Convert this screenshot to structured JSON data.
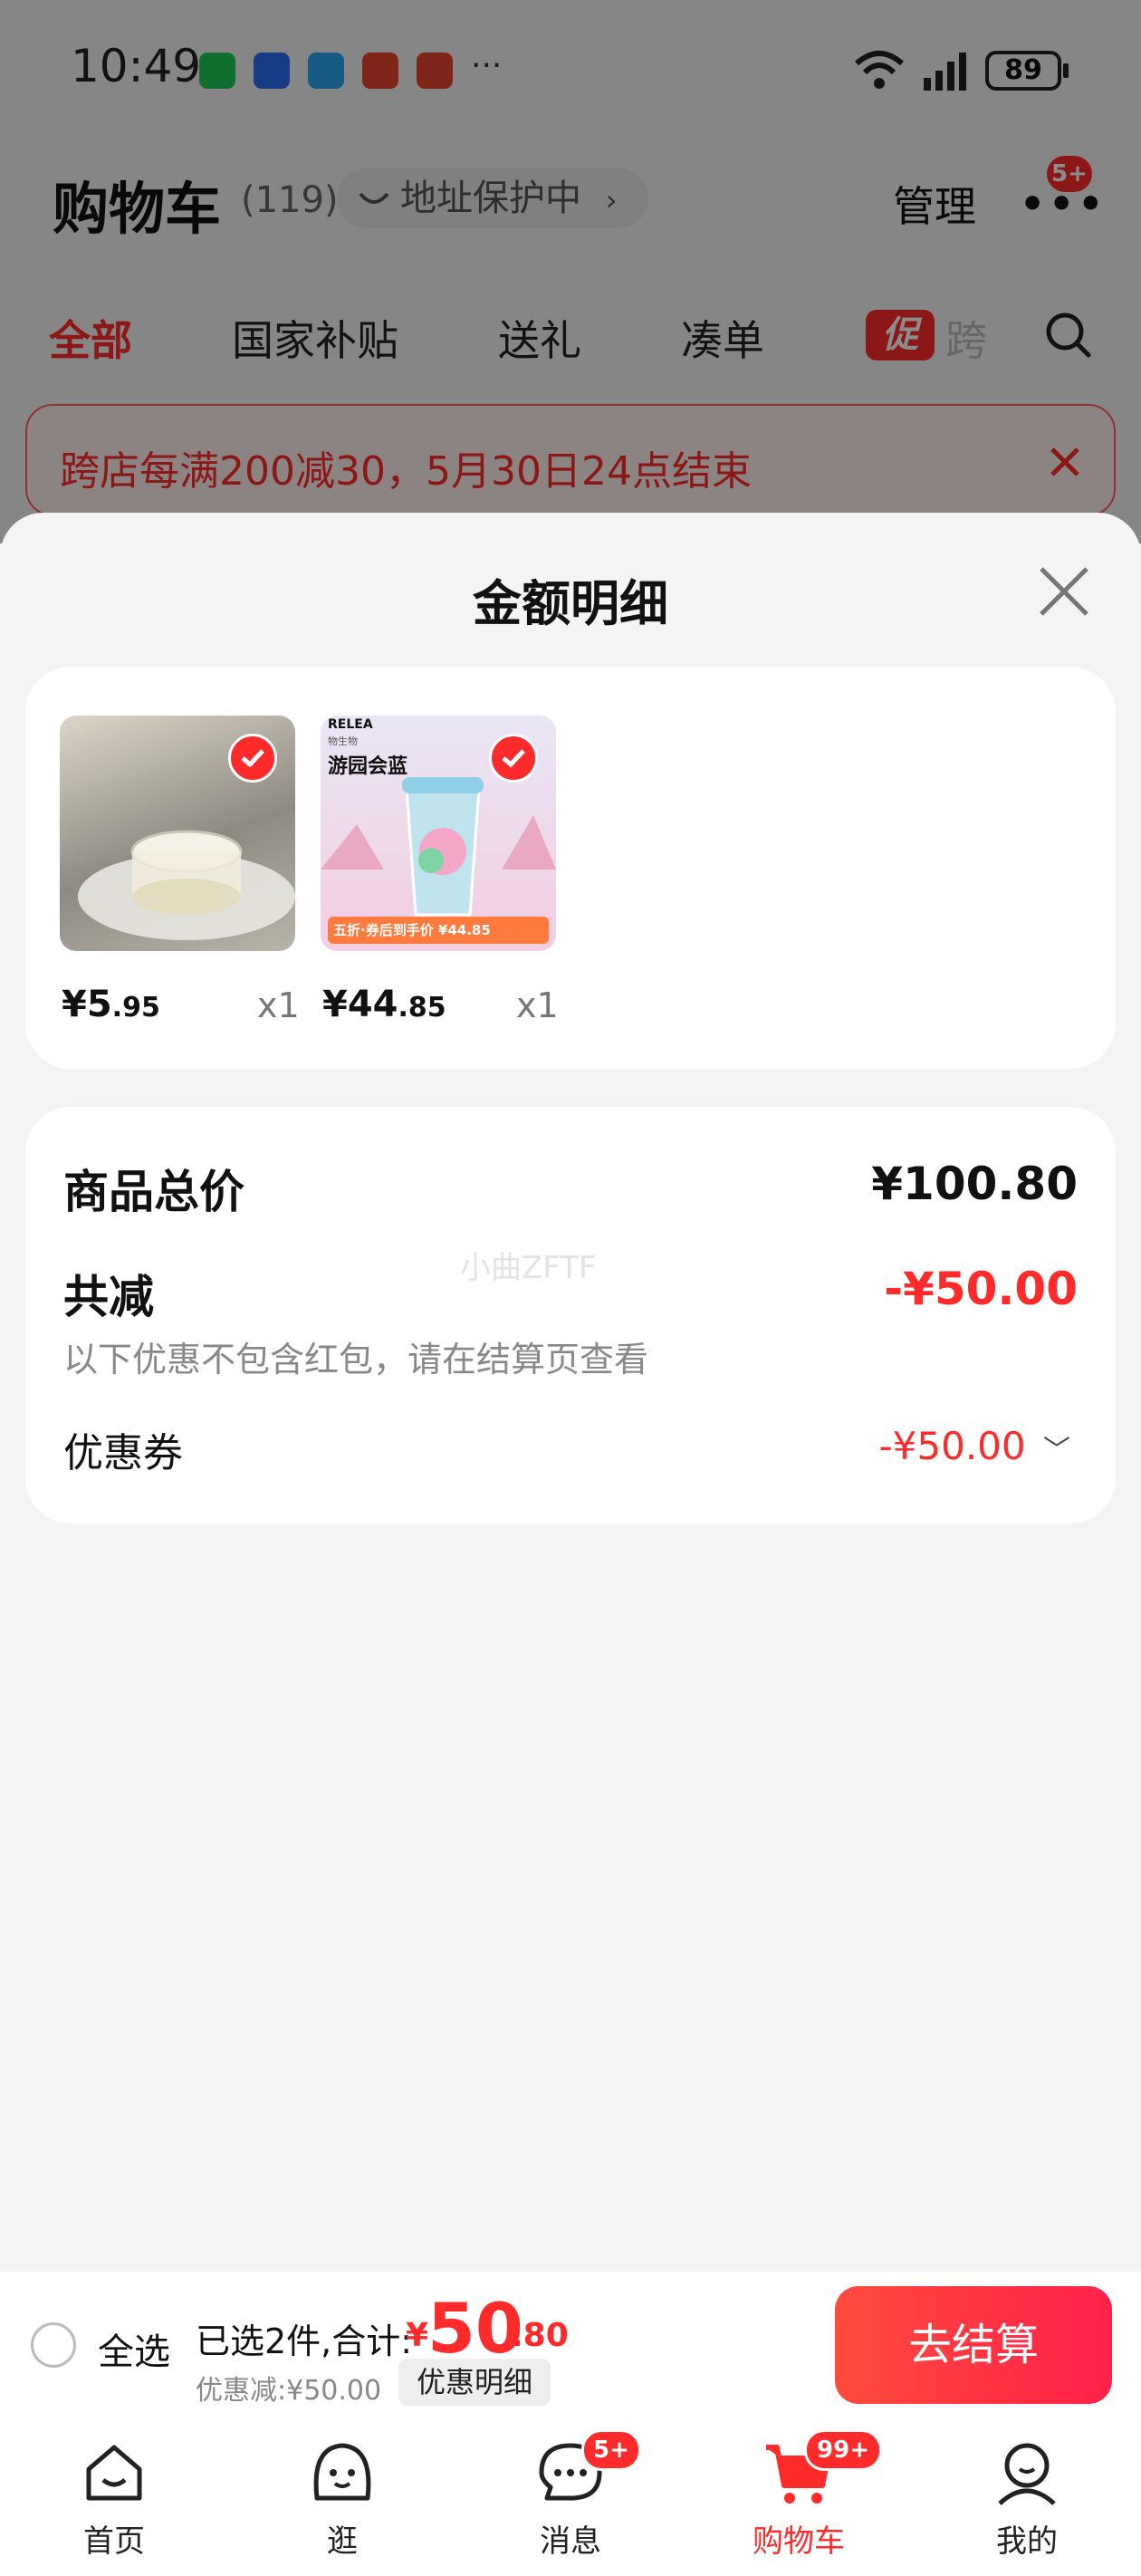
{
  "status_bar": {
    "time": "10:49",
    "battery": "89"
  },
  "header": {
    "title": "购物车",
    "count": "(119)",
    "address_pill": "地址保护中",
    "manage": "管理",
    "more_badge": "5+"
  },
  "tabs": [
    {
      "label": "全部",
      "active": true
    },
    {
      "label": "国家补贴"
    },
    {
      "label": "送礼"
    },
    {
      "label": "凑单"
    },
    {
      "label": "跨"
    }
  ],
  "promo_tag": "促",
  "notice": {
    "text": "跨店每满200减30，5月30日24点结束"
  },
  "sheet": {
    "title": "金额明细",
    "products": [
      {
        "price_int": "¥5",
        "price_dec": ".95",
        "qty": "x1"
      },
      {
        "price_int": "¥44",
        "price_dec": ".85",
        "qty": "x1",
        "image_text": {
          "brand": "RELEA",
          "sub": "物生物",
          "name": "游园会蓝",
          "banner": "五折·券后到手价 ¥44.85"
        }
      }
    ],
    "total_label": "商品总价",
    "total_value": "¥100.80",
    "discount_label": "共减",
    "discount_value": "-¥50.00",
    "discount_note": "以下优惠不包含红包，请在结算页查看",
    "coupon_label": "优惠券",
    "coupon_value": "-¥50.00",
    "watermark": "小曲ZFTF"
  },
  "checkout": {
    "select_all": "全选",
    "selected_text": "已选2件,合计:",
    "currency": "¥",
    "total_int": "50",
    "total_dec": ".80",
    "discount_text": "优惠减:¥50.00",
    "detail_button": "优惠明细",
    "pay_button": "去结算"
  },
  "tabbar": [
    {
      "label": "首页",
      "icon": "home-icon"
    },
    {
      "label": "逛",
      "icon": "browse-icon"
    },
    {
      "label": "消息",
      "icon": "message-icon",
      "badge": "5+"
    },
    {
      "label": "购物车",
      "icon": "cart-icon",
      "badge": "99+",
      "active": true
    },
    {
      "label": "我的",
      "icon": "profile-icon"
    }
  ],
  "colors": {
    "accent": "#ff2a2a",
    "background": "#f4f4f4"
  }
}
